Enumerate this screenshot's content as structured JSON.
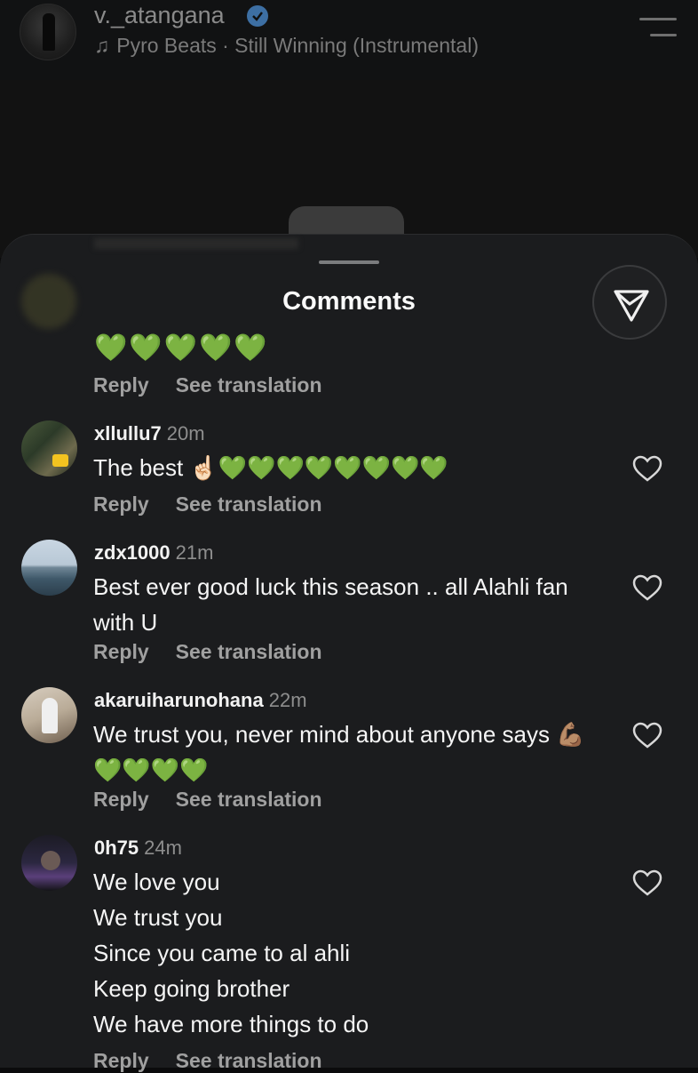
{
  "header": {
    "username": "v._atangana",
    "audio": "Pyro Beats · Still Winning (Instrumental)"
  },
  "sheet": {
    "title": "Comments"
  },
  "first_comment": {
    "emojis": "💚💚💚💚💚",
    "reply": "Reply",
    "see_translation": "See translation"
  },
  "comments": [
    {
      "user": "xllullu7",
      "time": "20m",
      "text": "The best ☝🏻💚💚💚💚💚💚💚💚",
      "reply": "Reply",
      "see_translation": "See translation"
    },
    {
      "user": "zdx1000",
      "time": "21m",
      "text": "Best ever good luck this season .. all Alahli fan with U",
      "reply": "Reply",
      "see_translation": "See translation"
    },
    {
      "user": "akaruiharunohana",
      "time": "22m",
      "text": "We trust you, never mind about anyone says 💪🏽💚💚💚💚",
      "reply": "Reply",
      "see_translation": "See translation"
    },
    {
      "user": "0h75",
      "time": "24m",
      "lines": [
        "We love you",
        "We trust you",
        "Since you came to al ahli",
        "Keep going brother",
        "We have more things to do"
      ],
      "reply": "Reply",
      "see_translation": "See translation"
    }
  ],
  "colors": {
    "sheet_bg": "#1b1c1e",
    "verified": "#3d6fa3"
  }
}
